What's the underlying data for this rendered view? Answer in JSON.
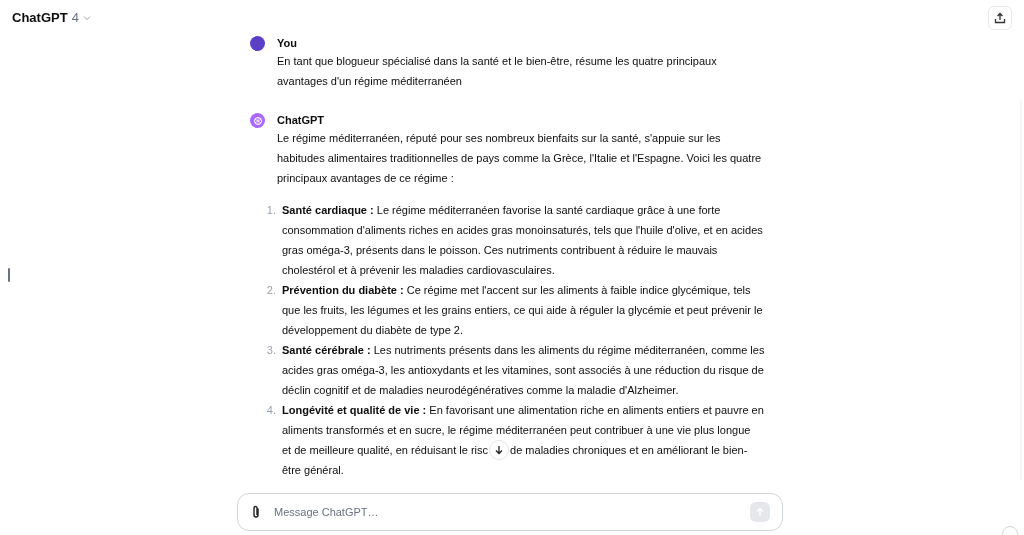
{
  "header": {
    "model_name": "ChatGPT",
    "model_version": "4"
  },
  "messages": [
    {
      "author": "You",
      "kind": "user",
      "paragraphs": [
        "En tant que blogueur spécialisé dans la santé et le bien-être, résume les quatre principaux avantages d'un régime méditerranéen"
      ]
    },
    {
      "author": "ChatGPT",
      "kind": "assistant",
      "paragraphs": [
        "Le régime méditerranéen, réputé pour ses nombreux bienfaits sur la santé, s'appuie sur les habitudes alimentaires traditionnelles de pays comme la Grèce, l'Italie et l'Espagne. Voici les quatre principaux avantages de ce régime :"
      ],
      "list": [
        {
          "number": "1.",
          "text": "**Santé cardiaque :** Le régime méditerranéen favorise la santé cardiaque grâce à une forte consommation d'aliments riches en acides gras monoinsaturés, tels que l'huile d'olive, et en acides gras oméga-3, présents dans le poisson. Ces nutriments contribuent à réduire le mauvais cholestérol et à prévenir les maladies cardiovasculaires."
        },
        {
          "number": "2.",
          "text": "**Prévention du diabète :** Ce régime met l'accent sur les aliments à faible indice glycémique, tels que les fruits, les légumes et les grains entiers, ce qui aide à réguler la glycémie et peut prévenir le développement du diabète de type 2."
        },
        {
          "number": "3.",
          "text": "**Santé cérébrale :** Les nutriments présents dans les aliments du régime méditerranéen, comme les acides gras oméga-3, les antioxydants et les vitamines, sont associés à une réduction du risque de déclin cognitif et de maladies neurodégénératives comme la maladie d'Alzheimer."
        },
        {
          "number": "4.",
          "text": "**Longévité et qualité de vie :** En favorisant une alimentation riche en aliments entiers et pauvre en aliments transformés et en sucre, le régime méditerranéen peut contribuer à une vie plus longue",
          "overlaid_line": [
            "et de meilleure qualité, en réduisant le risc",
            "de maladies chroniques et en améliorant le bien-"
          ],
          "text_end": "être général."
        }
      ]
    }
  ],
  "composer": {
    "placeholder": "Message ChatGPT…"
  }
}
